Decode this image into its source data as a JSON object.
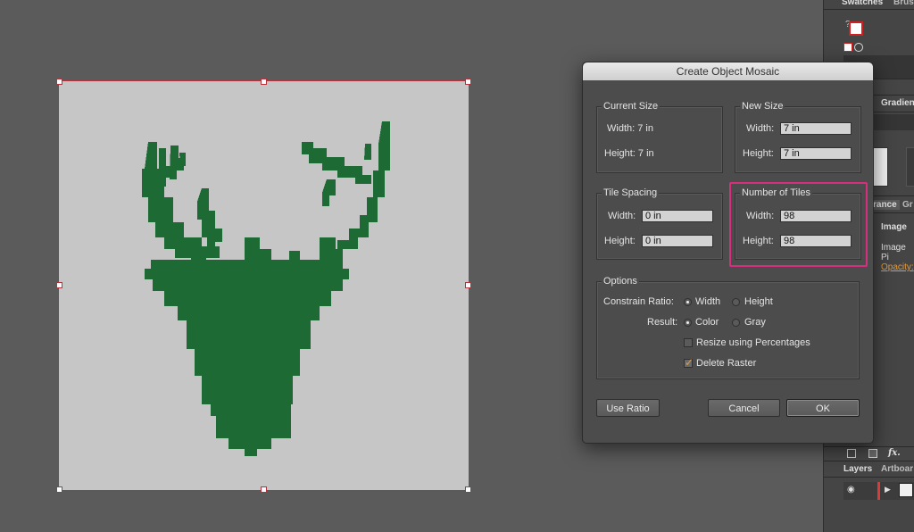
{
  "dialog": {
    "title": "Create Object Mosaic",
    "current_size": {
      "title": "Current Size",
      "width_label": "Width: 7 in",
      "height_label": "Height: 7 in"
    },
    "new_size": {
      "title": "New Size",
      "width_label": "Width:",
      "width_value": "7 in",
      "height_label": "Height:",
      "height_value": "7 in"
    },
    "tile_spacing": {
      "title": "Tile Spacing",
      "width_label": "Width:",
      "width_value": "0 in",
      "height_label": "Height:",
      "height_value": "0 in"
    },
    "number_of_tiles": {
      "title": "Number of Tiles",
      "width_label": "Width:",
      "width_value": "98",
      "height_label": "Height:",
      "height_value": "98"
    },
    "options": {
      "title": "Options",
      "constrain_label": "Constrain Ratio:",
      "constrain_width": "Width",
      "constrain_height": "Height",
      "result_label": "Result:",
      "result_color": "Color",
      "result_gray": "Gray",
      "resize_pct": "Resize using Percentages",
      "delete_raster": "Delete Raster"
    },
    "buttons": {
      "use_ratio": "Use Ratio",
      "cancel": "Cancel",
      "ok": "OK"
    }
  },
  "panels": {
    "swatches_tab": "Swatches",
    "brushes_tab": "Brush",
    "gradient_tab": "Gradien",
    "appearance_tab": "rance",
    "graphic_tab": "Gr",
    "image_label": "Image",
    "image_pixels_label": "Image Pi",
    "opacity_label": "Opacity:",
    "layers_tab": "Layers",
    "artboards_tab": "Artboar",
    "fx_label": "fx."
  },
  "colors": {
    "deer": "#1e6a34",
    "artboard": "#c6c6c6",
    "highlight": "#d62f7e",
    "selection": "#b4323c"
  }
}
